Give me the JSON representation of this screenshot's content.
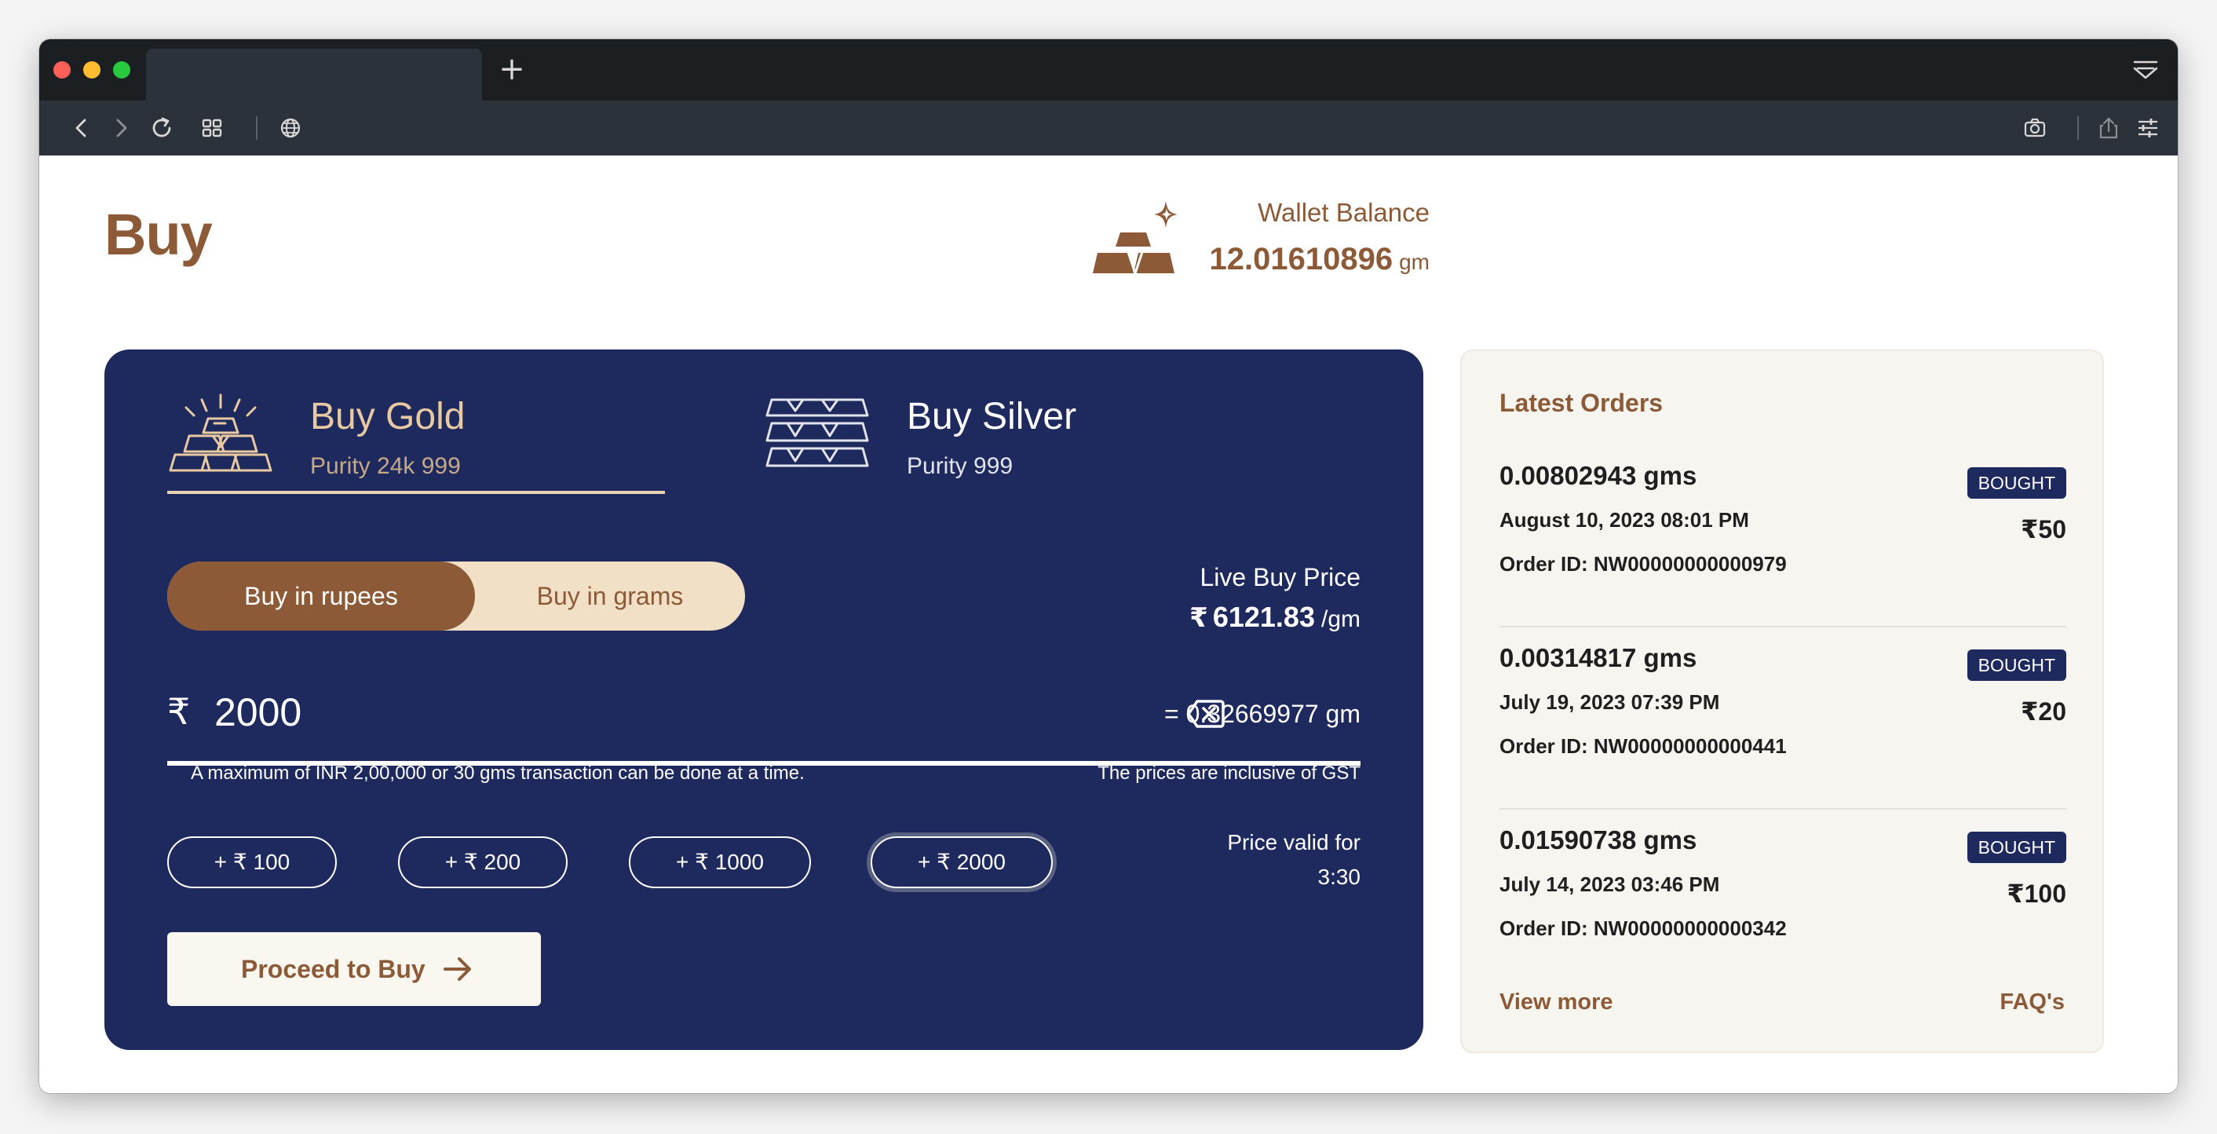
{
  "colors": {
    "brand_brown": "#8c5a36",
    "card_navy": "#1e2a5e",
    "gold_light": "#e8c9a1",
    "toggle_cream": "#f1dfc6",
    "orders_bg": "#f7f5f0"
  },
  "browser": {
    "new_tab_label": "+",
    "icons": [
      "back-icon",
      "forward-icon",
      "reload-icon",
      "tab-grid-icon",
      "globe-icon",
      "camera-icon",
      "share-icon",
      "settings-sliders-icon",
      "tab-menu-icon"
    ]
  },
  "header": {
    "title": "Buy",
    "wallet": {
      "label": "Wallet Balance",
      "value": "12.01610896",
      "unit": "gm",
      "icon": "gold-bars-sparkle-icon"
    }
  },
  "buy_card": {
    "metals": [
      {
        "title": "Buy Gold",
        "purity": "Purity 24k 999",
        "icon": "gold-bars-icon",
        "active": true
      },
      {
        "title": "Buy Silver",
        "purity": "Purity 999",
        "icon": "silver-bars-icon",
        "active": false
      }
    ],
    "mode_toggle": {
      "options": [
        "Buy in rupees",
        "Buy in grams"
      ],
      "selected": "Buy in rupees"
    },
    "live_price": {
      "label": "Live Buy Price",
      "currency": "₹",
      "value": "6121.83",
      "unit": "/gm"
    },
    "amount": {
      "currency": "₹",
      "value": "2000",
      "grams_equivalent": "= 0.32669977 gm"
    },
    "notes": {
      "limit": "A maximum of INR 2,00,000 or 30 gms transaction can be done at a time.",
      "gst": "The prices are inclusive of GST"
    },
    "quick_add": [
      {
        "label": "+ ₹ 100"
      },
      {
        "label": "+ ₹ 200"
      },
      {
        "label": "+ ₹ 1000"
      },
      {
        "label": "+ ₹ 2000",
        "selected": true
      }
    ],
    "validity": {
      "label": "Price valid for",
      "time": "3:30"
    },
    "proceed_label": "Proceed to Buy"
  },
  "orders": {
    "title": "Latest Orders",
    "items": [
      {
        "qty": "0.00802943 gms",
        "date": "August 10, 2023 08:01 PM",
        "order_id": "Order ID: NW00000000000979",
        "status": "BOUGHT",
        "amount": "₹50"
      },
      {
        "qty": "0.00314817 gms",
        "date": "July 19, 2023 07:39 PM",
        "order_id": "Order ID: NW00000000000441",
        "status": "BOUGHT",
        "amount": "₹20"
      },
      {
        "qty": "0.01590738 gms",
        "date": "July 14, 2023 03:46 PM",
        "order_id": "Order ID: NW00000000000342",
        "status": "BOUGHT",
        "amount": "₹100"
      }
    ],
    "view_more": "View more",
    "faqs": "FAQ's"
  }
}
